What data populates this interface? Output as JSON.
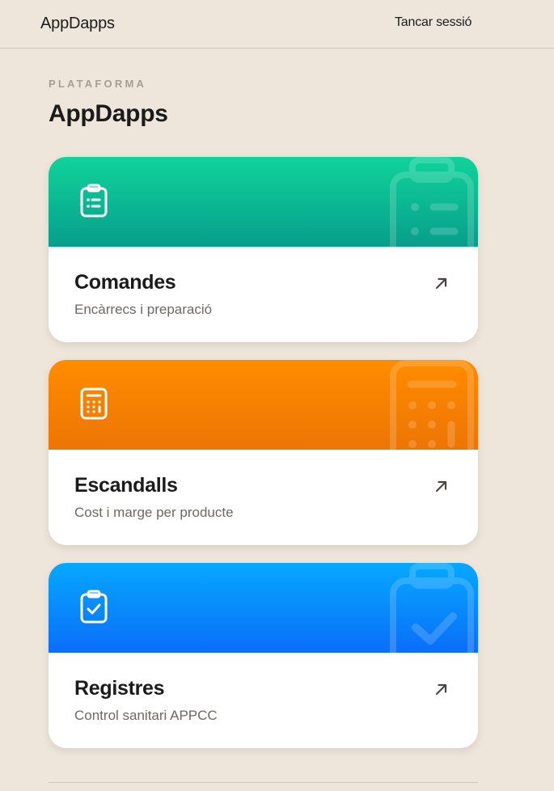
{
  "header": {
    "brand": "AppDapps",
    "logout_label": "Tancar sessió"
  },
  "intro": {
    "eyebrow": "PLATAFORMA",
    "title": "AppDapps"
  },
  "cards": [
    {
      "title": "Comandes",
      "subtitle": "Encàrrecs i preparació",
      "icon": "clipboard-list-icon",
      "color_start": "#10d39a",
      "color_end": "#079e8b"
    },
    {
      "title": "Escandalls",
      "subtitle": "Cost i marge per producte",
      "icon": "calculator-icon",
      "color_start": "#ff8c00",
      "color_end": "#ec7504"
    },
    {
      "title": "Registres",
      "subtitle": "Control sanitari APPCC",
      "icon": "clipboard-check-icon",
      "color_start": "#06a8ff",
      "color_end": "#0a6ef8"
    }
  ],
  "colors": {
    "background": "#efe6db",
    "text": "#1b1b1b",
    "muted": "#6f6861",
    "eyebrow": "#a79e93"
  }
}
